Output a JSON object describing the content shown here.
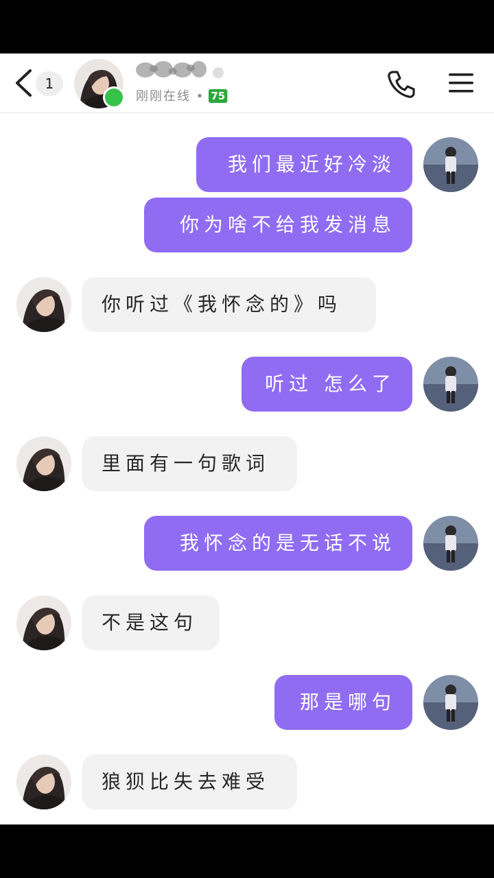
{
  "header": {
    "unread_count": "1",
    "status_text": "刚刚在线 •",
    "level": "75"
  },
  "messages": [
    {
      "side": "out",
      "text": "我们最近好冷淡"
    },
    {
      "side": "out",
      "text": "你为啥不给我发消息"
    },
    {
      "side": "in",
      "text": "你听过《我怀念的》吗"
    },
    {
      "side": "out",
      "text": "听过 怎么了"
    },
    {
      "side": "in",
      "text": "里面有一句歌词"
    },
    {
      "side": "out",
      "text": "我怀念的是无话不说"
    },
    {
      "side": "in",
      "text": "不是这句"
    },
    {
      "side": "out",
      "text": "那是哪句"
    },
    {
      "side": "in",
      "text": "狼狈比失去难受"
    }
  ],
  "colors": {
    "outgoing_bubble": "#8f6cf2",
    "incoming_bubble": "#f2f2f2",
    "online": "#36c24b",
    "level_badge": "#2aa83a"
  },
  "icons": [
    "back-icon",
    "phone-icon",
    "menu-icon"
  ]
}
